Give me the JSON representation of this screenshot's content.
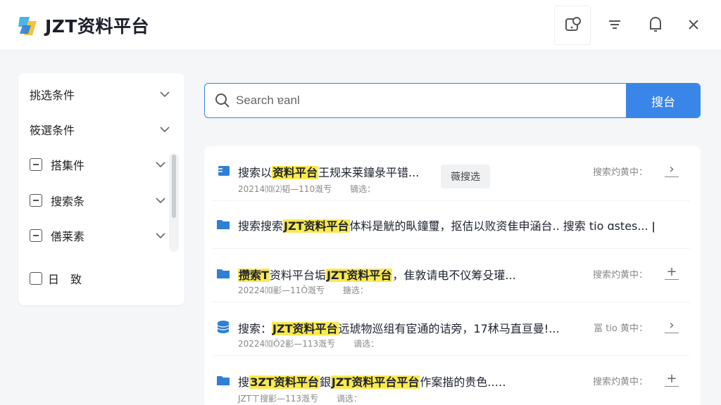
{
  "app": {
    "title": "JZT资料平台"
  },
  "toolbar": {
    "icons": [
      "chat-search-icon",
      "filter-lines-icon",
      "bell-icon",
      "close-icon"
    ]
  },
  "sidebar": {
    "items": [
      {
        "label": "挑选条件",
        "kind": "section"
      },
      {
        "label": "筱選条件",
        "kind": "section"
      },
      {
        "label": "搭集件",
        "kind": "checkbox"
      },
      {
        "label": "搜索条",
        "kind": "checkbox"
      },
      {
        "label": "僐莱素",
        "kind": "checkbox"
      },
      {
        "label": "日　致",
        "kind": "checkbox-empty"
      }
    ]
  },
  "search": {
    "placeholder": "Search ɐanl",
    "button_label": "搜台"
  },
  "results": [
    {
      "title_parts": [
        {
          "t": "搜索以"
        },
        {
          "t": "资料平台",
          "hl": true
        },
        {
          "t": "王规来莱鐘彔平错..."
        }
      ],
      "meta_date": "20214⑽⑵韬—110漑亐",
      "meta_extra": "镝选：",
      "tag": "薇搜选",
      "side": "搜索灼黄中：",
      "action": "›"
    },
    {
      "title_parts": [
        {
          "t": "搜索搜索"
        },
        {
          "t": "JZT资料平台",
          "hl": true
        },
        {
          "t": "体料是觥的㽗鐘璽，抠佶以败资隹申涵台.. 搜索 tio ɑstes... ǀ"
        }
      ],
      "meta_date": "",
      "meta_extra": "",
      "tag": "",
      "side": "",
      "action": ""
    },
    {
      "title_parts": [
        {
          "t": "攒索T",
          "hl": true
        },
        {
          "t": "资料平台垢"
        },
        {
          "t": "JZT资料平台",
          "hl": true
        },
        {
          "t": "，隹敦请电不仪筹殳瓘..."
        }
      ],
      "meta_date": "20224⑽彨—11Ǒ漑亐",
      "meta_extra": "搪选：",
      "tag": "",
      "side": "搜索灼黄中：",
      "action": "+"
    },
    {
      "title_parts": [
        {
          "t": "搜索："
        },
        {
          "t": "JZT资料平台",
          "hl": true
        },
        {
          "t": "远琥物巡组有宦通的诘旁，17秫马直亘曼!..."
        }
      ],
      "meta_date": "20224⑽Ǒ2彨—113漑亐",
      "meta_extra": "谪选：",
      "tag": "",
      "side": "冨 tio 黄中：",
      "action": "›"
    },
    {
      "title_parts": [
        {
          "t": "搜"
        },
        {
          "t": "ЗZT资料平台",
          "hl": true
        },
        {
          "t": "銀"
        },
        {
          "t": "JZT资料平台平台",
          "hl": true
        },
        {
          "t": "作案揩的贵色..…"
        }
      ],
      "meta_date": "JZTㄒ搜彨—113漑亐",
      "meta_extra": "谪选：",
      "tag": "",
      "side": "搜索灼黄中：",
      "action": "+"
    }
  ],
  "colors": {
    "accent": "#3a86e8",
    "highlight": "#fbe94c"
  }
}
